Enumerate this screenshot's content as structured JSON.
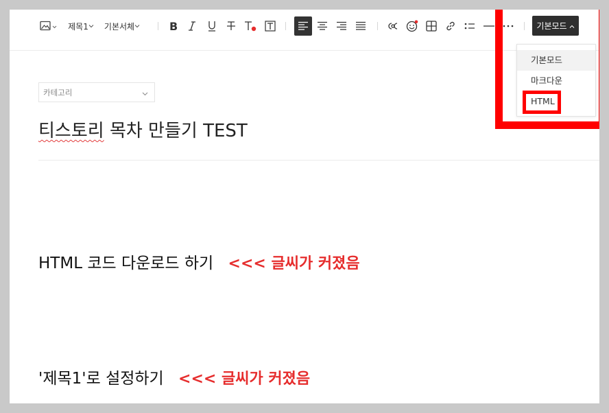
{
  "toolbar": {
    "image_icon": "image-icon",
    "heading_select": "제목1",
    "font_select": "기본서체",
    "buttons": [
      "bold-icon",
      "italic-icon",
      "underline-icon",
      "strikethrough-icon",
      "text-color-icon",
      "text-background-icon",
      "align-left-icon",
      "align-center-icon",
      "align-right-icon",
      "align-justify-icon",
      "quote-icon",
      "emoticon-icon",
      "table-icon",
      "link-icon",
      "list-icon",
      "horizontal-rule-icon",
      "more-icon"
    ],
    "accent_color": "#e62d2d",
    "mode_button": "기본모드"
  },
  "mode_menu": {
    "items": [
      "기본모드",
      "마크다운",
      "HTML"
    ],
    "highlighted": "HTML"
  },
  "editor": {
    "category_placeholder": "카테고리",
    "title_underlined": "티스토리",
    "title_rest": " 목차 만들기 TEST",
    "lines": [
      {
        "text": "HTML 코드 다운로드 하기",
        "note": "<<<   글씨가 커졌음"
      },
      {
        "text": "'제목1'로 설정하기",
        "note": "<<<   글씨가 커졌음"
      }
    ]
  }
}
